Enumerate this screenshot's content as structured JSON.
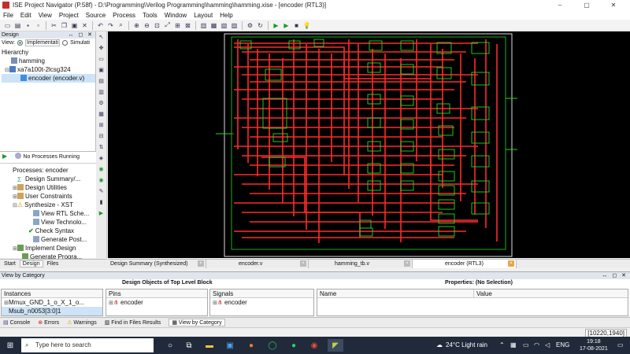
{
  "window": {
    "title": "ISE Project Navigator (P.58f) - D:\\Programming\\Verilog Programming\\hamming\\hamming.xise - [encoder (RTL3)]",
    "controls": [
      "–",
      "▢",
      "✕"
    ]
  },
  "menu": [
    "File",
    "Edit",
    "View",
    "Project",
    "Source",
    "Process",
    "Tools",
    "Window",
    "Layout",
    "Help"
  ],
  "toolbar": {
    "icons": [
      "new-file-icon",
      "open-icon",
      "save-icon",
      "save-all-icon",
      "print-icon",
      "cut-icon",
      "copy-icon",
      "paste-icon",
      "delete-icon",
      "undo-icon",
      "redo-icon",
      "find-icon",
      "no-icon",
      "no-icon",
      "window-icon",
      "select-all-icon",
      "zoom-in-icon",
      "zoom-out-icon",
      "zoom-full-icon",
      "zoom-selection-icon",
      "zoom-fit-icon",
      "add-pin-icon",
      "tile-icon",
      "tile-vertical-icon",
      "cascade-icon",
      "float-icon",
      "settings-icon",
      "refresh-icon",
      "run-icon",
      "run-all-icon",
      "stop-icon",
      "help-icon"
    ]
  },
  "design_panel": {
    "header": "Design",
    "view_label": "View:",
    "view_options": [
      "Implementati",
      "Simulati"
    ],
    "hierarchy_label": "Hierarchy",
    "tree": [
      {
        "label": "hamming",
        "indent": 0
      },
      {
        "label": "xa7a100t-2lcsg324",
        "indent": 0
      },
      {
        "label": "encoder (encoder.v)",
        "indent": 1
      }
    ],
    "no_process": "No Processes Running",
    "processes_label": "Processes: encoder",
    "processes": [
      {
        "label": "Design Summary/...",
        "indent": 1,
        "icon": "summary"
      },
      {
        "label": "Design Utilities",
        "indent": 0,
        "icon": "tool"
      },
      {
        "label": "User Constraints",
        "indent": 0,
        "icon": "tool"
      },
      {
        "label": "Synthesize - XST",
        "indent": 0,
        "icon": "warn"
      },
      {
        "label": "View RTL Sche...",
        "indent": 1,
        "icon": "doc"
      },
      {
        "label": "View Technolo...",
        "indent": 1,
        "icon": "doc"
      },
      {
        "label": "Check Syntax",
        "indent": 1,
        "icon": "ok"
      },
      {
        "label": "Generate Post...",
        "indent": 1,
        "icon": "doc"
      },
      {
        "label": "Implement Design",
        "indent": 0,
        "icon": "run"
      },
      {
        "label": "Generate Progra...",
        "indent": 1,
        "icon": "run"
      }
    ],
    "tabs": [
      "Start",
      "Design",
      "Files"
    ]
  },
  "doc_tabs": [
    {
      "label": "Design Summary (Synthesized)",
      "active": false
    },
    {
      "label": "encoder.v",
      "active": false
    },
    {
      "label": "hamming_tb.v",
      "active": false
    },
    {
      "label": "encoder (RTL3)",
      "active": true
    }
  ],
  "view_by_category": {
    "header": "View by Category",
    "design_objects_title": "Design Objects of Top Level Block",
    "properties_title": "Properties: (No Selection)",
    "instances": {
      "header": "Instances",
      "rows": [
        "Mmux_GND_1_o_X_1_o...",
        "Msub_n0053[3:0]1"
      ]
    },
    "pins": {
      "header": "Pins",
      "rows": [
        "encoder"
      ]
    },
    "signals": {
      "header": "Signals",
      "rows": [
        "encoder"
      ]
    },
    "properties": {
      "name_col": "Name",
      "value_col": "Value"
    }
  },
  "console_tabs": [
    "Console",
    "Errors",
    "Warnings",
    "Find in Files Results",
    "View by Category"
  ],
  "status": {
    "coords": "[10220,1940]"
  },
  "taskbar": {
    "search_placeholder": "Type here to search",
    "weather": "24°C  Light rain",
    "lang": "ENG",
    "time": "19:18",
    "date": "17-08-2021"
  }
}
